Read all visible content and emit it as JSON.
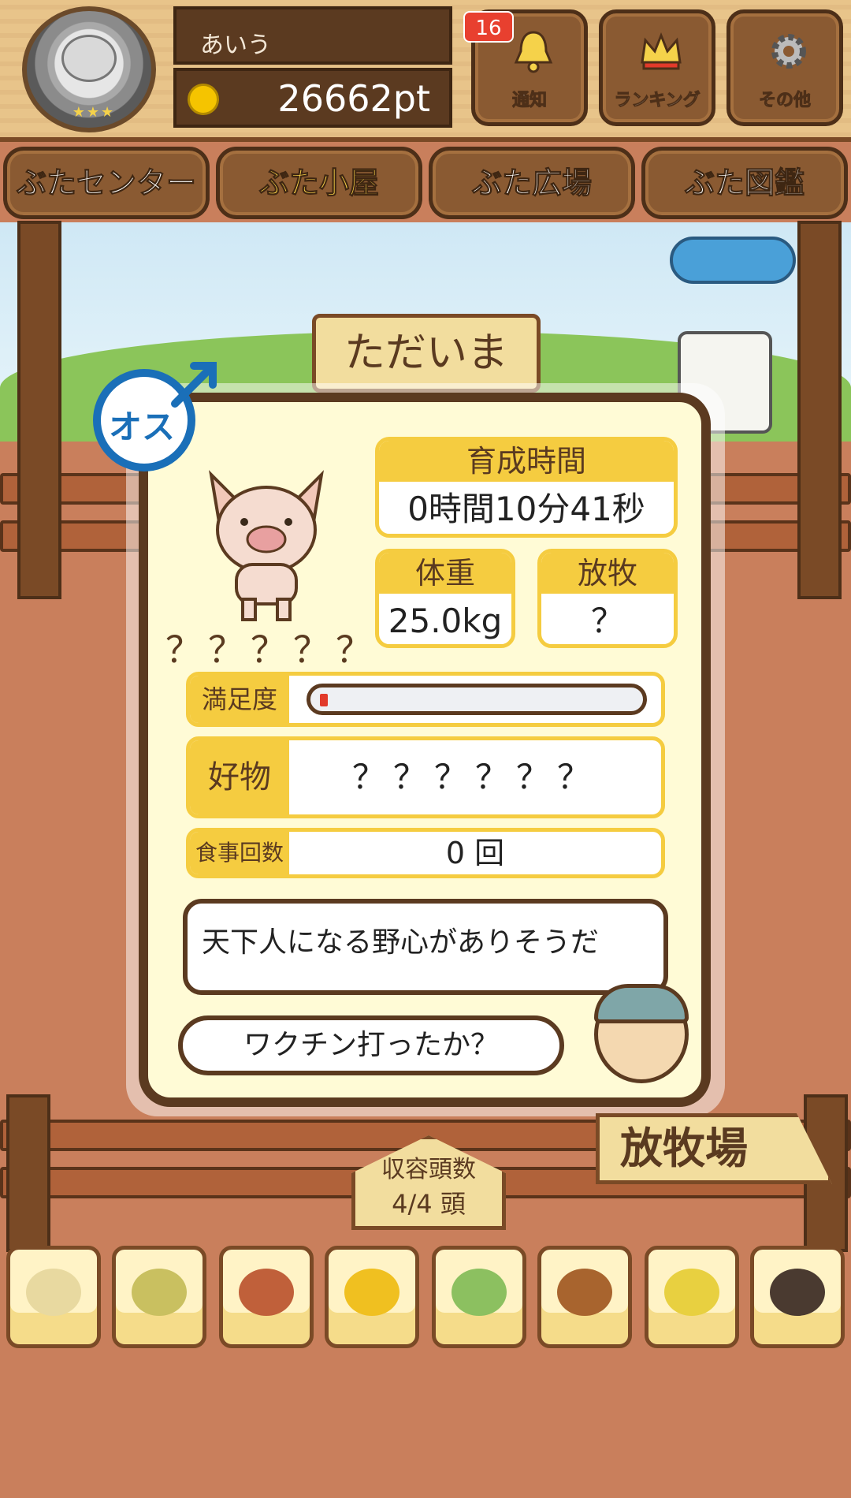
{
  "header": {
    "username": "あいう",
    "points": "26662pt",
    "notice_badge": "16",
    "buttons": {
      "notice": "通知",
      "ranking": "ランキング",
      "other": "その他"
    }
  },
  "tabs": [
    {
      "label": "ぶたセンター",
      "active": false
    },
    {
      "label": "ぶた小屋",
      "active": true
    },
    {
      "label": "ぶた広場",
      "active": false
    },
    {
      "label": "ぶた図鑑",
      "active": false
    }
  ],
  "scene": {
    "sign": "ただいま"
  },
  "pig_card": {
    "gender_label": "オス",
    "name": "？？？？？",
    "raise_time_label": "育成時間",
    "raise_time_value": "0時間10分41秒",
    "weight_label": "体重",
    "weight_value": "25.0kg",
    "graze_label": "放牧",
    "graze_value": "？",
    "satisfaction_label": "満足度",
    "satisfaction_level": 0.02,
    "favorite_label": "好物",
    "favorite_value": "？？？？？？",
    "meal_count_label": "食事回数",
    "meal_count_value": "0 回",
    "comment": "天下人になる野心がありそうだ",
    "farmer_speech": "ワクチン打ったか？"
  },
  "capacity": {
    "label": "収容頭数",
    "value": "4/4 頭"
  },
  "graze_sign": "放牧場",
  "foods": [
    {
      "name": "grain-icon",
      "color": "#e8d9a0"
    },
    {
      "name": "mixed-grain-icon",
      "color": "#c9c060"
    },
    {
      "name": "sweet-potato-icon",
      "color": "#c0603a"
    },
    {
      "name": "corn-icon",
      "color": "#f0c020"
    },
    {
      "name": "beans-icon",
      "color": "#8cc060"
    },
    {
      "name": "acorn-icon",
      "color": "#a8642e"
    },
    {
      "name": "premium-feed-icon",
      "color": "#e8d040"
    },
    {
      "name": "truffle-icon",
      "color": "#4a3a30"
    }
  ],
  "colors": {
    "accent_yellow": "#f5cc40",
    "wood_dark": "#5b3a20",
    "male_blue": "#1a6fb8",
    "satisfaction_red": "#e23a2a"
  }
}
